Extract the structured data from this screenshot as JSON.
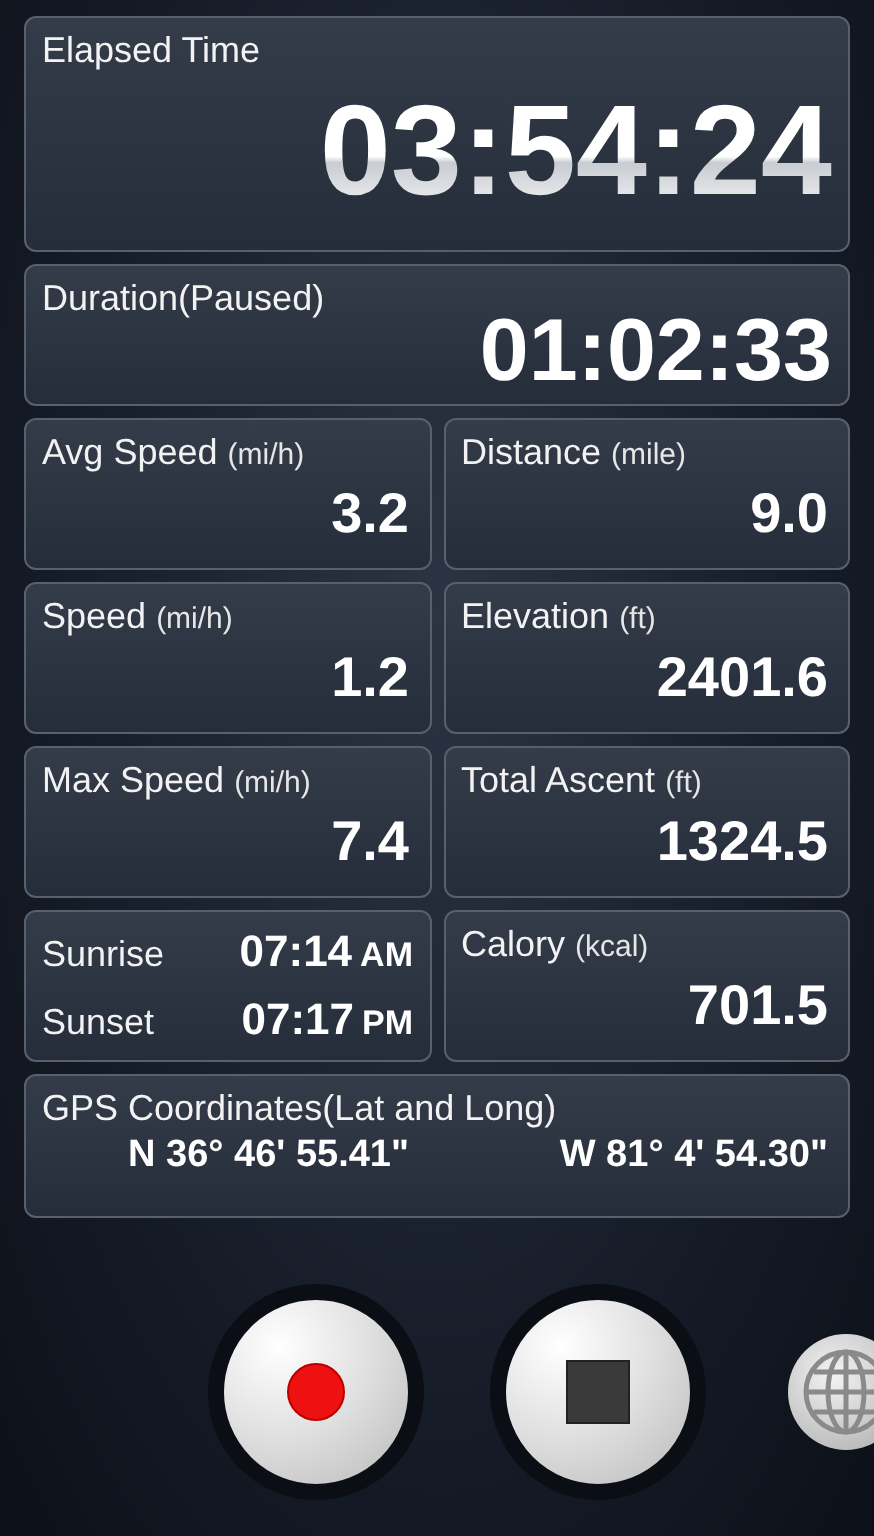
{
  "elapsed": {
    "label": "Elapsed Time",
    "value": "03:54:24"
  },
  "duration": {
    "label": "Duration(Paused)",
    "value": "01:02:33"
  },
  "cells": [
    {
      "kind": "metric",
      "label": "Avg Speed",
      "unit": "(mi/h)",
      "value": "3.2"
    },
    {
      "kind": "metric",
      "label": "Distance",
      "unit": "(mile)",
      "value": "9.0"
    },
    {
      "kind": "metric",
      "label": "Speed",
      "unit": "(mi/h)",
      "value": "1.2"
    },
    {
      "kind": "metric",
      "label": "Elevation",
      "unit": "(ft)",
      "value": "2401.6"
    },
    {
      "kind": "metric",
      "label": "Max Speed",
      "unit": "(mi/h)",
      "value": "7.4"
    },
    {
      "kind": "metric",
      "label": "Total Ascent",
      "unit": "(ft)",
      "value": "1324.5"
    },
    {
      "kind": "sun",
      "rows": [
        {
          "label": "Sunrise",
          "time": "07:14",
          "period": "AM"
        },
        {
          "label": "Sunset",
          "time": "07:17",
          "period": "PM"
        }
      ]
    },
    {
      "kind": "metric",
      "label": "Calory",
      "unit": "(kcal)",
      "value": "701.5"
    }
  ],
  "gps": {
    "label": "GPS Coordinates(Lat and Long)",
    "lat": "N 36° 46' 55.41\"",
    "long": "W 81° 4' 54.30\""
  }
}
